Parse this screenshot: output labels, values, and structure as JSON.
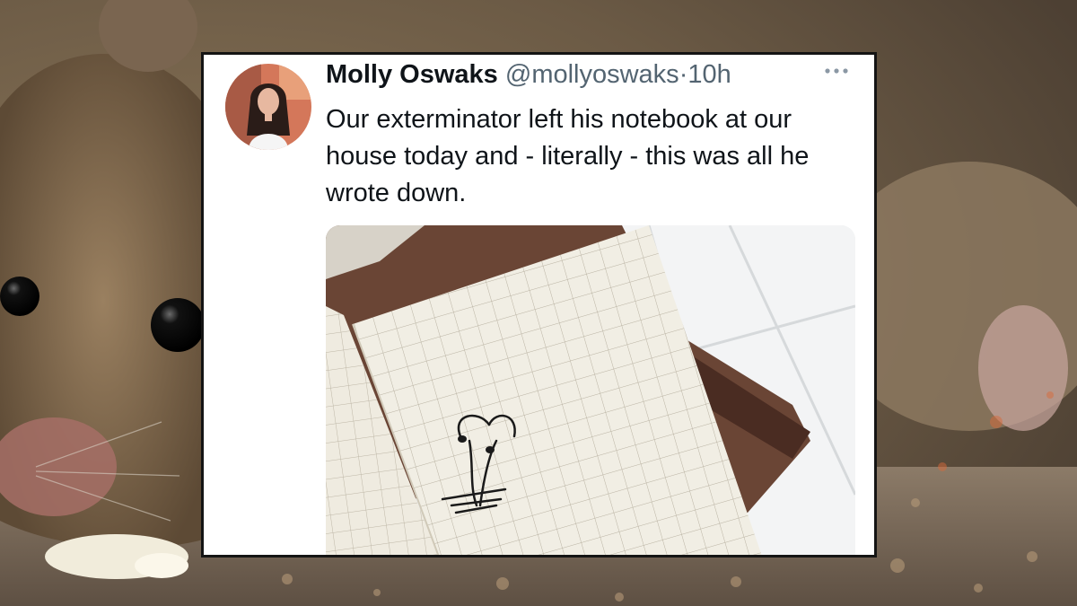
{
  "tweet": {
    "display_name": "Molly Oswaks",
    "handle": "@mollyoswaks",
    "separator": "·",
    "time": "10h",
    "more_icon": "more-dots-icon",
    "text": "Our exterminator left his notebook at our house today and - literally - this was all he wrote down."
  },
  "colors": {
    "card_bg": "#ffffff",
    "name": "#0f1419",
    "secondary": "#536471",
    "card_border": "#141414"
  }
}
